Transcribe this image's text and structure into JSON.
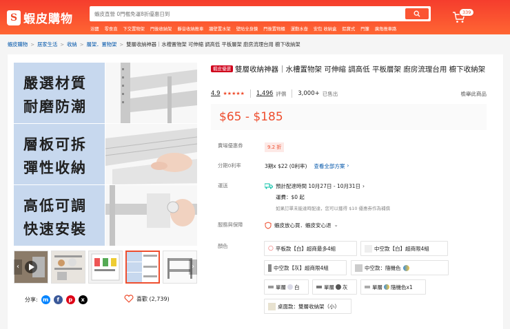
{
  "header": {
    "brand": "蝦皮購物",
    "search_placeholder": "蝦皮直營 0門檻免運8折優惠日到",
    "quick_links": [
      "浴鹽",
      "零食直",
      "下交置物架",
      "門後收納架",
      "靜音收納推車",
      "牆壁置水架",
      "壁貼全身鏡",
      "門後置物櫃",
      "運動水壺",
      "安包 收納盒",
      "鋁寶式",
      "門簾",
      "廣角推車路"
    ],
    "cart_count": "339"
  },
  "breadcrumbs": [
    "蝦皮購物",
    "居家生活",
    "收納",
    "層架．置物架",
    "雙層收納神器｜水槽置物架 可伸縮 調高低 平板層架 廚房流理台用 櫥下收納架"
  ],
  "gallery": {
    "panels": [
      "嚴選材質",
      "耐磨防潮",
      "層板可拆",
      "彈性收納",
      "高低可調",
      "快速安裝"
    ]
  },
  "share": {
    "label": "分享:",
    "likes_label": "喜歡 (2,739)"
  },
  "product": {
    "badge": "蝦皮優選",
    "title": "雙層收納神器｜水槽置物架 可伸縮 調高低 平板層架 廚房流理台用 櫥下收納架",
    "rating": "4.9",
    "stars": "★★★★★",
    "reviews_count": "1,496",
    "reviews_label": "評價",
    "sold_count": "3,000+",
    "sold_label": "已售出",
    "report": "檢舉此商品",
    "price": "$65 - $185"
  },
  "rows": {
    "voucher_label": "賣場優惠券",
    "voucher": "9.2 折",
    "installment_label": "分期0利率",
    "installment": "3期x $22 (0利率)",
    "installment_link": "查看全部方案",
    "shipping_label": "運送",
    "shipping_eta": "預計配達時間 10月27日 - 10月31日",
    "shipping_fee": "運費：$0 起",
    "shipping_note": "如果訂單未能達時配達，您可以獲得 $10 優惠券作為補償",
    "guarantee_label": "服務與保障",
    "guarantee": "蝦皮放心買．蝦皮安心退",
    "color_label": "顏色"
  },
  "options": [
    "平板款【白】超商最多4組",
    "中空款【白】超商限4組",
    "中空款【灰】超商限4組",
    "中空款：隨機色",
    "單層",
    "白",
    "單層",
    "灰",
    "單層",
    "隨機色x1",
    "桌面款：雙層收納架（小）"
  ],
  "colors": {
    "brand": "#ee4d2d",
    "link": "#0055aa",
    "shipping_green": "#00bfa5"
  }
}
